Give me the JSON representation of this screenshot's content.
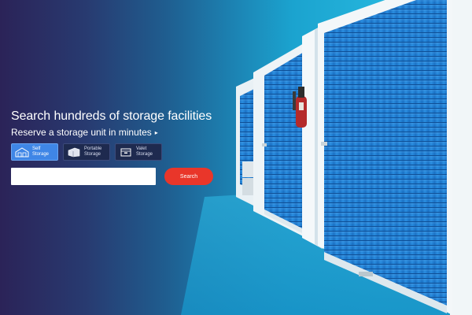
{
  "hero": {
    "headline": "Search hundreds of storage facilities",
    "subline": "Reserve a storage unit in minutes",
    "subline_arrow": "▸"
  },
  "tabs": [
    {
      "label": "Self Storage",
      "icon": "storage-building-icon",
      "active": true
    },
    {
      "label": "Portable Storage",
      "icon": "portable-container-icon",
      "active": false
    },
    {
      "label": "Valet Storage",
      "icon": "storage-box-icon",
      "active": false
    }
  ],
  "search": {
    "value": "",
    "placeholder": "",
    "button_label": "Search"
  },
  "colors": {
    "accent": "#e9362a",
    "active_tab": "#3f86e6",
    "tab_bg": "#1e2a4f",
    "door_blue": "#1f7fcf",
    "gradient_dark": "#2b2358",
    "gradient_light": "#2ab8de"
  }
}
